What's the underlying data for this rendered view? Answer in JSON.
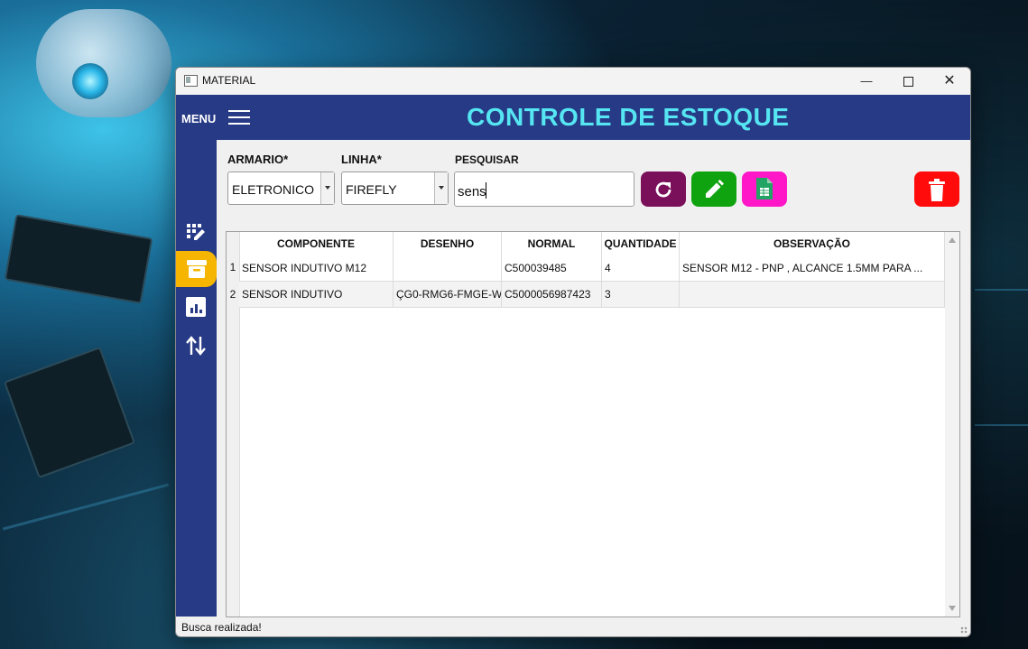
{
  "window": {
    "title": "MATERIAL"
  },
  "header": {
    "menu_label": "MENU",
    "title": "CONTROLE DE ESTOQUE"
  },
  "sidebar": {
    "items": [
      {
        "icon": "edit-grid-icon",
        "active": false
      },
      {
        "icon": "archive-box-icon",
        "active": true
      },
      {
        "icon": "bar-chart-icon",
        "active": false
      },
      {
        "icon": "up-down-arrows-icon",
        "active": false
      }
    ]
  },
  "filters": {
    "armario_label": "ARMARIO*",
    "armario_value": "ELETRONICO",
    "linha_label": "LINHA*",
    "linha_value": "FIREFLY",
    "pesquisar_label": "PESQUISAR",
    "search_value": "sens"
  },
  "actions": {
    "refresh_color": "#7a0f5a",
    "edit_color": "#0fa30f",
    "sheet_color": "#ff17c8",
    "delete_color": "#ff0b0b"
  },
  "table": {
    "columns": [
      "COMPONENTE",
      "DESENHO",
      "NORMAL",
      "QUANTIDADE",
      "OBSERVAÇÃO"
    ],
    "rows": [
      {
        "num": "1",
        "componente": "SENSOR INDUTIVO M12",
        "desenho": "",
        "normal": "C500039485",
        "quantidade": "4",
        "observacao": "SENSOR M12 - PNP , ALCANCE 1.5MM PARA ..."
      },
      {
        "num": "2",
        "componente": "SENSOR INDUTIVO",
        "desenho": "ÇG0-RMG6-FMGE-W",
        "normal": "C5000056987423",
        "quantidade": "3",
        "observacao": ""
      }
    ]
  },
  "status": {
    "text": "Busca realizada!"
  },
  "colors": {
    "header_bg": "#273a86",
    "title_color": "#55e6f2",
    "active_sidebar": "#f6b500"
  }
}
